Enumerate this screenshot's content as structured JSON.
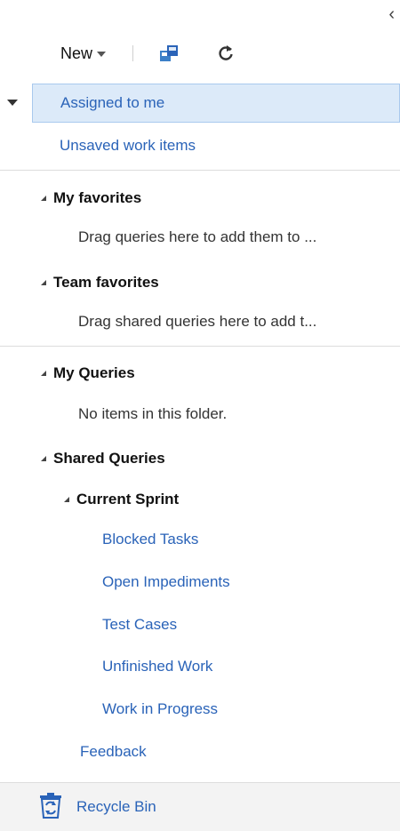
{
  "toolbar": {
    "new_label": "New"
  },
  "tree": {
    "assigned_to_me": "Assigned to me",
    "unsaved_work_items": "Unsaved work items",
    "my_favorites": "My favorites",
    "my_favorites_hint": "Drag queries here to add them to ...",
    "team_favorites": "Team favorites",
    "team_favorites_hint": "Drag shared queries here to add t...",
    "my_queries": "My Queries",
    "my_queries_empty": "No items in this folder.",
    "shared_queries": "Shared Queries",
    "current_sprint": "Current Sprint",
    "sprint_items": [
      "Blocked Tasks",
      "Open Impediments",
      "Test Cases",
      "Unfinished Work",
      "Work in Progress"
    ],
    "feedback": "Feedback"
  },
  "footer": {
    "recycle_bin": "Recycle Bin"
  },
  "colors": {
    "link": "#2a63b8",
    "selected_bg": "#dceaf9",
    "selected_border": "#a9c9ee",
    "footer_bg": "#f3f3f3"
  },
  "icons": {
    "collapse": "chevron-left-icon",
    "new_caret": "caret-down-icon",
    "save": "save-query-icon",
    "refresh": "refresh-icon",
    "recycle": "recycle-bin-icon"
  }
}
